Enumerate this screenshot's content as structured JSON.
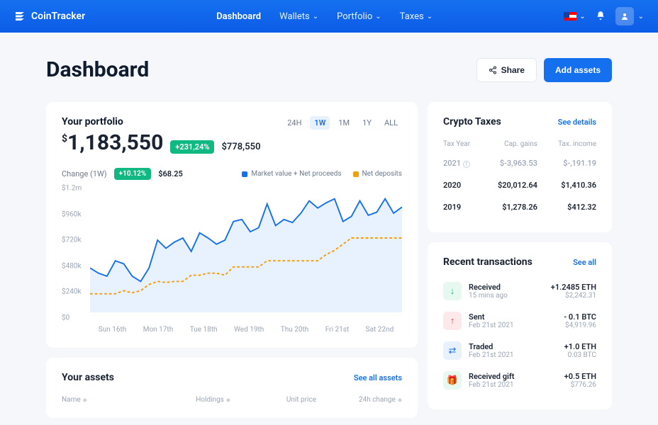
{
  "brand": "CoinTracker",
  "nav": {
    "dashboard": "Dashboard",
    "wallets": "Wallets",
    "portfolio": "Portfolio",
    "taxes": "Taxes"
  },
  "page": {
    "title": "Dashboard",
    "share": "Share",
    "add_assets": "Add assets"
  },
  "portfolio": {
    "title": "Your portfolio",
    "currency": "$",
    "amount": "1,183,550",
    "change_pct": "+231,24%",
    "sub_amount": "$778,550",
    "change_label": "Change (1W)",
    "change_small_pct": "+10.12%",
    "change_small_amt": "$68.25",
    "legend_mv": "Market value + Net proceeds",
    "legend_nd": "Net deposits",
    "ranges": [
      "24H",
      "1W",
      "1M",
      "1Y",
      "ALL"
    ]
  },
  "chart_data": {
    "type": "line",
    "x": [
      "Sun 16th",
      "Mon 17th",
      "Tue 18th",
      "Wed 19th",
      "Thu 20th",
      "Fri 21st",
      "Sat 22nd"
    ],
    "ylim": [
      0,
      1200000
    ],
    "yticks": [
      "$0",
      "$240k",
      "$480k",
      "$720k",
      "$960k",
      "$1.2m"
    ],
    "series": [
      {
        "name": "Market value + Net proceeds",
        "color": "#1570ef",
        "values": [
          430,
          380,
          350,
          500,
          470,
          350,
          300,
          430,
          700,
          620,
          680,
          720,
          590,
          770,
          720,
          660,
          700,
          880,
          900,
          780,
          820,
          1050,
          840,
          900,
          870,
          960,
          1080,
          1010,
          1060,
          1100,
          880,
          930,
          1080,
          940,
          970,
          1100,
          960,
          1020
        ]
      },
      {
        "name": "Net deposits",
        "color": "#f59e0b",
        "values": [
          180,
          180,
          180,
          180,
          210,
          190,
          210,
          270,
          300,
          290,
          300,
          300,
          360,
          360,
          380,
          380,
          360,
          440,
          440,
          440,
          440,
          500,
          500,
          500,
          500,
          500,
          500,
          500,
          560,
          600,
          660,
          720,
          720,
          720,
          720,
          720,
          720,
          720
        ]
      }
    ]
  },
  "taxes": {
    "title": "Crypto Taxes",
    "see": "See details",
    "headers": {
      "year": "Tax Year",
      "gains": "Cap. gains",
      "income": "Tax. income"
    },
    "rows": [
      {
        "year": "2021",
        "gains": "$-3,963.53",
        "income": "$-,191.19",
        "muted": true
      },
      {
        "year": "2020",
        "gains": "$20,012.64",
        "income": "$1,410.36"
      },
      {
        "year": "2019",
        "gains": "$1,278.26",
        "income": "$412.32"
      }
    ]
  },
  "transactions": {
    "title": "Recent transactions",
    "see": "See all",
    "items": [
      {
        "icon": "↓",
        "cls": "green",
        "type": "Received",
        "time": "15 mins ago",
        "amt": "+1.2485 ETH",
        "usd": "$2,242.31"
      },
      {
        "icon": "↑",
        "cls": "red",
        "type": "Sent",
        "time": "Feb 21st 2021",
        "amt": "- 0.1 BTC",
        "usd": "$4,919.96"
      },
      {
        "icon": "⇄",
        "cls": "blue",
        "type": "Traded",
        "time": "Feb 21st 2021",
        "amt": "+1.0 ETH",
        "usd": "0.03 BTC"
      },
      {
        "icon": "🎁",
        "cls": "gift",
        "type": "Received gift",
        "time": "Feb 21st 2021",
        "amt": "+0.5 ETH",
        "usd": "$776.26"
      }
    ]
  },
  "assets": {
    "title": "Your assets",
    "see": "See all assets",
    "cols": {
      "name": "Name",
      "holdings": "Holdings",
      "price": "Unit price",
      "change": "24h change"
    }
  }
}
